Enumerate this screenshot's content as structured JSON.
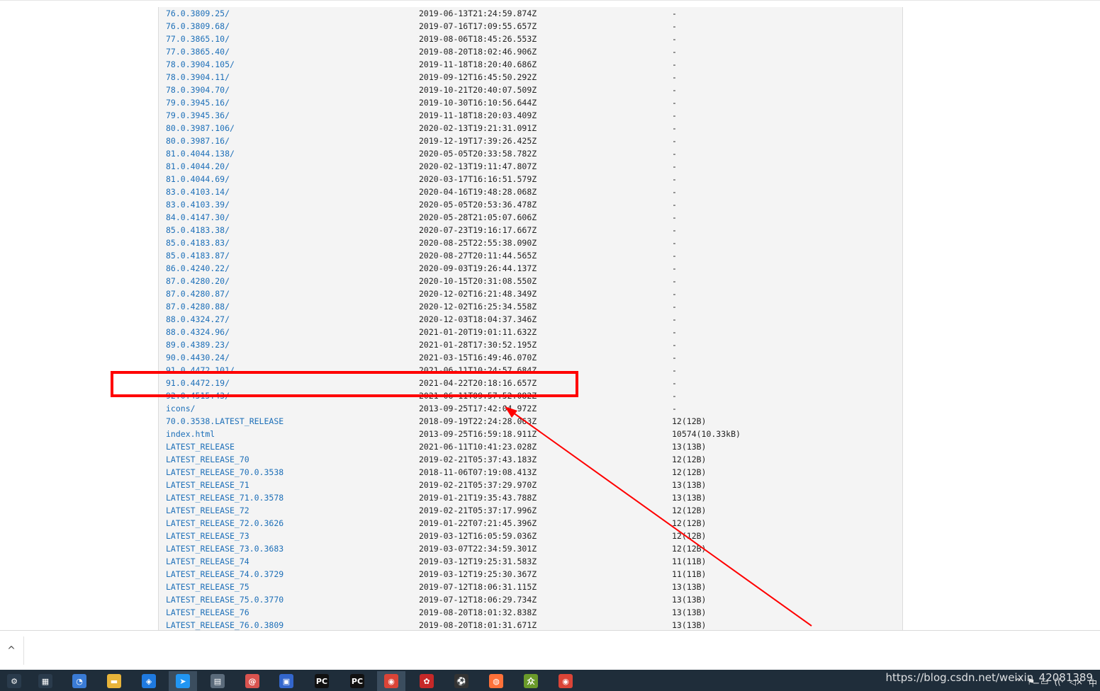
{
  "listing": {
    "rows": [
      {
        "name": "76.0.3809.25/",
        "date": "2019-06-13T21:24:59.874Z",
        "size": "-"
      },
      {
        "name": "76.0.3809.68/",
        "date": "2019-07-16T17:09:55.657Z",
        "size": "-"
      },
      {
        "name": "77.0.3865.10/",
        "date": "2019-08-06T18:45:26.553Z",
        "size": "-"
      },
      {
        "name": "77.0.3865.40/",
        "date": "2019-08-20T18:02:46.906Z",
        "size": "-"
      },
      {
        "name": "78.0.3904.105/",
        "date": "2019-11-18T18:20:40.686Z",
        "size": "-"
      },
      {
        "name": "78.0.3904.11/",
        "date": "2019-09-12T16:45:50.292Z",
        "size": "-"
      },
      {
        "name": "78.0.3904.70/",
        "date": "2019-10-21T20:40:07.509Z",
        "size": "-"
      },
      {
        "name": "79.0.3945.16/",
        "date": "2019-10-30T16:10:56.644Z",
        "size": "-"
      },
      {
        "name": "79.0.3945.36/",
        "date": "2019-11-18T18:20:03.409Z",
        "size": "-"
      },
      {
        "name": "80.0.3987.106/",
        "date": "2020-02-13T19:21:31.091Z",
        "size": "-"
      },
      {
        "name": "80.0.3987.16/",
        "date": "2019-12-19T17:39:26.425Z",
        "size": "-"
      },
      {
        "name": "81.0.4044.138/",
        "date": "2020-05-05T20:33:58.782Z",
        "size": "-"
      },
      {
        "name": "81.0.4044.20/",
        "date": "2020-02-13T19:11:47.807Z",
        "size": "-"
      },
      {
        "name": "81.0.4044.69/",
        "date": "2020-03-17T16:16:51.579Z",
        "size": "-"
      },
      {
        "name": "83.0.4103.14/",
        "date": "2020-04-16T19:48:28.068Z",
        "size": "-"
      },
      {
        "name": "83.0.4103.39/",
        "date": "2020-05-05T20:53:36.478Z",
        "size": "-"
      },
      {
        "name": "84.0.4147.30/",
        "date": "2020-05-28T21:05:07.606Z",
        "size": "-"
      },
      {
        "name": "85.0.4183.38/",
        "date": "2020-07-23T19:16:17.667Z",
        "size": "-"
      },
      {
        "name": "85.0.4183.83/",
        "date": "2020-08-25T22:55:38.090Z",
        "size": "-"
      },
      {
        "name": "85.0.4183.87/",
        "date": "2020-08-27T20:11:44.565Z",
        "size": "-"
      },
      {
        "name": "86.0.4240.22/",
        "date": "2020-09-03T19:26:44.137Z",
        "size": "-"
      },
      {
        "name": "87.0.4280.20/",
        "date": "2020-10-15T20:31:08.550Z",
        "size": "-"
      },
      {
        "name": "87.0.4280.87/",
        "date": "2020-12-02T16:21:48.349Z",
        "size": "-"
      },
      {
        "name": "87.0.4280.88/",
        "date": "2020-12-02T16:25:34.558Z",
        "size": "-"
      },
      {
        "name": "88.0.4324.27/",
        "date": "2020-12-03T18:04:37.346Z",
        "size": "-"
      },
      {
        "name": "88.0.4324.96/",
        "date": "2021-01-20T19:01:11.632Z",
        "size": "-"
      },
      {
        "name": "89.0.4389.23/",
        "date": "2021-01-28T17:30:52.195Z",
        "size": "-"
      },
      {
        "name": "90.0.4430.24/",
        "date": "2021-03-15T16:49:46.070Z",
        "size": "-"
      },
      {
        "name": "91.0.4472.101/",
        "date": "2021-06-11T10:24:57.684Z",
        "size": "-"
      },
      {
        "name": "91.0.4472.19/",
        "date": "2021-04-22T20:18:16.657Z",
        "size": "-"
      },
      {
        "name": "92.0.4515.43/",
        "date": "2021-06-11T09:57:52.082Z",
        "size": "-"
      },
      {
        "name": "icons/",
        "date": "2013-09-25T17:42:04.972Z",
        "size": "-"
      },
      {
        "name": "70.0.3538.LATEST_RELEASE",
        "date": "2018-09-19T22:24:28.063Z",
        "size": "12(12B)"
      },
      {
        "name": "index.html",
        "date": "2013-09-25T16:59:18.911Z",
        "size": "10574(10.33kB)"
      },
      {
        "name": "LATEST_RELEASE",
        "date": "2021-06-11T10:41:23.028Z",
        "size": "13(13B)"
      },
      {
        "name": "LATEST_RELEASE_70",
        "date": "2019-02-21T05:37:43.183Z",
        "size": "12(12B)"
      },
      {
        "name": "LATEST_RELEASE_70.0.3538",
        "date": "2018-11-06T07:19:08.413Z",
        "size": "12(12B)"
      },
      {
        "name": "LATEST_RELEASE_71",
        "date": "2019-02-21T05:37:29.970Z",
        "size": "13(13B)"
      },
      {
        "name": "LATEST_RELEASE_71.0.3578",
        "date": "2019-01-21T19:35:43.788Z",
        "size": "13(13B)"
      },
      {
        "name": "LATEST_RELEASE_72",
        "date": "2019-02-21T05:37:17.996Z",
        "size": "12(12B)"
      },
      {
        "name": "LATEST_RELEASE_72.0.3626",
        "date": "2019-01-22T07:21:45.396Z",
        "size": "12(12B)"
      },
      {
        "name": "LATEST_RELEASE_73",
        "date": "2019-03-12T16:05:59.036Z",
        "size": "12(12B)"
      },
      {
        "name": "LATEST_RELEASE_73.0.3683",
        "date": "2019-03-07T22:34:59.301Z",
        "size": "12(12B)"
      },
      {
        "name": "LATEST_RELEASE_74",
        "date": "2019-03-12T19:25:31.583Z",
        "size": "11(11B)"
      },
      {
        "name": "LATEST_RELEASE_74.0.3729",
        "date": "2019-03-12T19:25:30.367Z",
        "size": "11(11B)"
      },
      {
        "name": "LATEST_RELEASE_75",
        "date": "2019-07-12T18:06:31.115Z",
        "size": "13(13B)"
      },
      {
        "name": "LATEST_RELEASE_75.0.3770",
        "date": "2019-07-12T18:06:29.734Z",
        "size": "13(13B)"
      },
      {
        "name": "LATEST_RELEASE_76",
        "date": "2019-08-20T18:01:32.838Z",
        "size": "13(13B)"
      },
      {
        "name": "LATEST_RELEASE_76.0.3809",
        "date": "2019-08-20T18:01:31.671Z",
        "size": "13(13B)"
      }
    ]
  },
  "download_bar": {
    "chevron_icon": "chevron-up-icon"
  },
  "annotation": {
    "box_color": "#ff0000",
    "arrow_color": "#ff0000"
  },
  "taskbar": {
    "icons": [
      {
        "name": "settings-icon",
        "glyph": "⚙",
        "color": "#2a3b4c"
      },
      {
        "name": "calculator-icon",
        "glyph": "▦",
        "color": "#2a3b4c"
      },
      {
        "name": "clock-app-icon",
        "glyph": "◔",
        "color": "#3a7bd5"
      },
      {
        "name": "file-explorer-icon",
        "glyph": "▬",
        "color": "#e8b43a"
      },
      {
        "name": "shield-app-icon",
        "glyph": "◈",
        "color": "#1f7ae0"
      },
      {
        "name": "send-app-icon",
        "glyph": "➤",
        "color": "#2196f3"
      },
      {
        "name": "network-tool-icon",
        "glyph": "▤",
        "color": "#5b6b7b"
      },
      {
        "name": "snail-app-icon",
        "glyph": "@",
        "color": "#d9534f"
      },
      {
        "name": "remote-desktop-icon",
        "glyph": "▣",
        "color": "#3366cc"
      },
      {
        "name": "pycharm-icon",
        "glyph": "PC",
        "color": "#111111"
      },
      {
        "name": "pycharm-alt-icon",
        "glyph": "PC",
        "color": "#111111"
      },
      {
        "name": "chrome-icon",
        "glyph": "◉",
        "color": "#db4437"
      },
      {
        "name": "huawei-app-icon",
        "glyph": "✿",
        "color": "#c62828"
      },
      {
        "name": "football-app-icon",
        "glyph": "⚽",
        "color": "#333333"
      },
      {
        "name": "firefox-icon",
        "glyph": "◍",
        "color": "#ff7139"
      },
      {
        "name": "notes-app-icon",
        "glyph": "众",
        "color": "#6a9a2a"
      },
      {
        "name": "chrome-alt-icon",
        "glyph": "◉",
        "color": "#db4437"
      }
    ],
    "tray": [
      "^",
      "⚑",
      "▭",
      "((·",
      "◁×",
      "中"
    ]
  },
  "watermark": {
    "text": "https://blog.csdn.net/weixin_42081389"
  }
}
